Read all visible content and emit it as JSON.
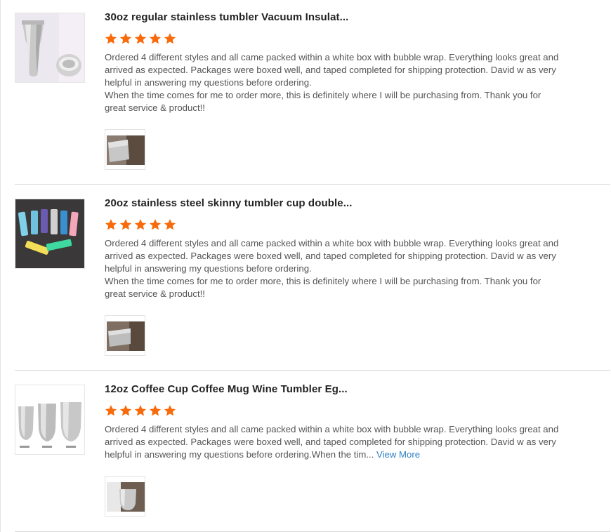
{
  "colors": {
    "star": "#f96a0a",
    "link": "#2f7fc4",
    "divider": "#d8d8d8"
  },
  "reviews": [
    {
      "title": "30oz regular stainless tumbler Vacuum Insulat...",
      "rating": 5,
      "text": [
        "Ordered 4 different styles and all came packed within a white box with bubble wrap. Everything looks great and arrived as expected. Packages were boxed well, and taped completed for shipping protection. David w as very helpful in answering my questions before ordering.",
        "When the time comes for me to order more, this is definitely where I will be purchasing from. Thank you for great service & product!!"
      ]
    },
    {
      "title": "20oz stainless steel skinny tumbler cup double...",
      "rating": 5,
      "text": [
        "Ordered 4 different styles and all came packed within a white box with bubble wrap. Everything looks great and arrived as expected. Packages were boxed well, and taped completed for shipping protection. David w as very helpful in answering my questions before ordering.",
        "When the time comes for me to order more, this is definitely where I will be purchasing from. Thank you for great service & product!!"
      ]
    },
    {
      "title": "12oz Coffee Cup Coffee Mug Wine Tumbler Eg...",
      "rating": 5,
      "text": [
        "Ordered 4 different styles and all came packed within a white box with bubble wrap. Everything looks great and arrived as expected. Packages were boxed well, and taped completed for shipping protection. David w as very helpful in answering my questions before ordering.When the tim..."
      ],
      "view_more": "View More"
    }
  ]
}
